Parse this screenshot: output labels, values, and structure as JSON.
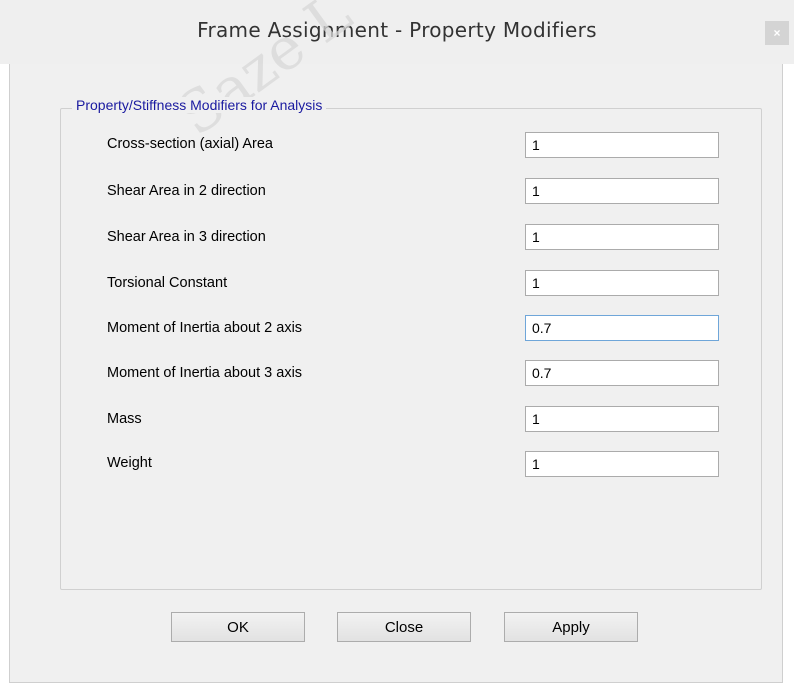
{
  "window": {
    "title": "Frame Assignment - Property Modifiers",
    "close_glyph": "×",
    "watermark": "Saze L"
  },
  "group": {
    "legend": "Property/Stiffness Modifiers for Analysis",
    "rows": [
      {
        "label": "Cross-section (axial) Area",
        "value": "1"
      },
      {
        "label": "Shear Area in 2 direction",
        "value": "1"
      },
      {
        "label": "Shear Area in 3 direction",
        "value": "1"
      },
      {
        "label": "Torsional Constant",
        "value": "1"
      },
      {
        "label": "Moment of Inertia about 2 axis",
        "value": "0.7"
      },
      {
        "label": "Moment of Inertia about 3 axis",
        "value": "0.7"
      },
      {
        "label": "Mass",
        "value": "1"
      },
      {
        "label": "Weight",
        "value": "1"
      }
    ]
  },
  "buttons": {
    "ok": "OK",
    "close": "Close",
    "apply": "Apply"
  },
  "colors": {
    "legend_text": "#1a1aa0",
    "focus_border": "#6fa6d9",
    "dialog_bg": "#f0f0f0"
  }
}
